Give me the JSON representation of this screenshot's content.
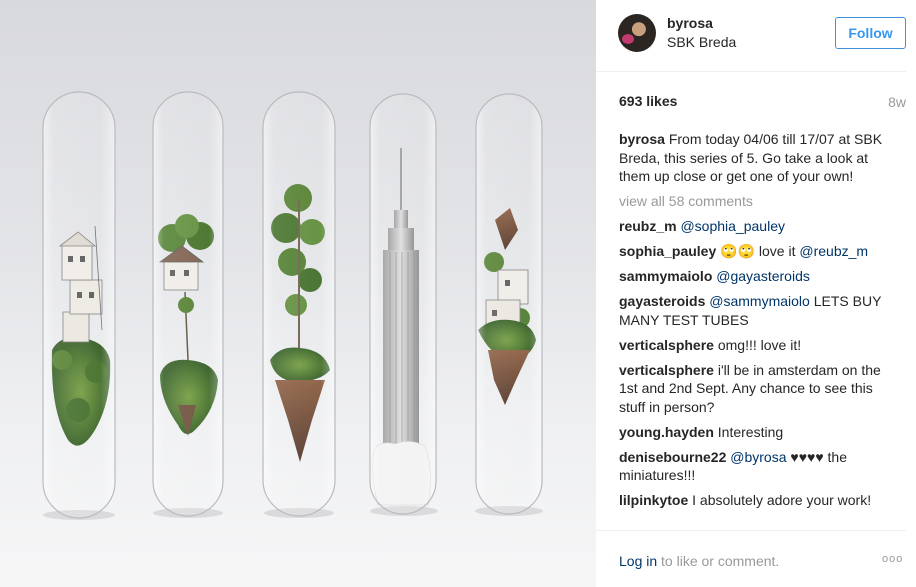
{
  "post": {
    "username": "byrosa",
    "location": "SBK Breda",
    "follow_label": "Follow",
    "likes": "693 likes",
    "age": "8w"
  },
  "caption": {
    "user": "byrosa",
    "text": "From today 04/06 till 17/07 at SBK Breda, this series of 5. Go take a look at them up close or get one of your own!"
  },
  "view_all": "view all 58 comments",
  "comments": [
    {
      "user": "reubz_m",
      "parts": [
        {
          "t": "@sophia_pauley",
          "m": true
        }
      ]
    },
    {
      "user": "sophia_pauley",
      "parts": [
        {
          "t": "🙄🙄 love it ",
          "m": false
        },
        {
          "t": "@reubz_m",
          "m": true
        }
      ]
    },
    {
      "user": "sammymaiolo",
      "parts": [
        {
          "t": "@gayasteroids",
          "m": true
        }
      ]
    },
    {
      "user": "gayasteroids",
      "parts": [
        {
          "t": "@sammymaiolo",
          "m": true
        },
        {
          "t": " LETS BUY MANY TEST TUBES",
          "m": false
        }
      ]
    },
    {
      "user": "verticalsphere",
      "parts": [
        {
          "t": "omg!!! love it!",
          "m": false
        }
      ]
    },
    {
      "user": "verticalsphere",
      "parts": [
        {
          "t": "i'll be in amsterdam on the 1st and 2nd Sept. Any chance to see this stuff in person?",
          "m": false
        }
      ]
    },
    {
      "user": "young.hayden",
      "parts": [
        {
          "t": "Interesting",
          "m": false
        }
      ]
    },
    {
      "user": "denisebourne22",
      "parts": [
        {
          "t": "@byrosa",
          "m": true
        },
        {
          "t": " ♥♥♥♥ the miniatures!!!",
          "m": false
        }
      ]
    },
    {
      "user": "lilpinkytoe",
      "parts": [
        {
          "t": "I absolutely adore your work!",
          "m": false
        }
      ]
    }
  ],
  "footer": {
    "login_link": "Log in",
    "login_rest": " to like or comment.",
    "more_label": "ooo"
  },
  "icons": {
    "more": "more-options-icon"
  },
  "colors": {
    "link": "#003569",
    "follow": "#3897f0",
    "muted": "#999999",
    "text": "#262626"
  }
}
